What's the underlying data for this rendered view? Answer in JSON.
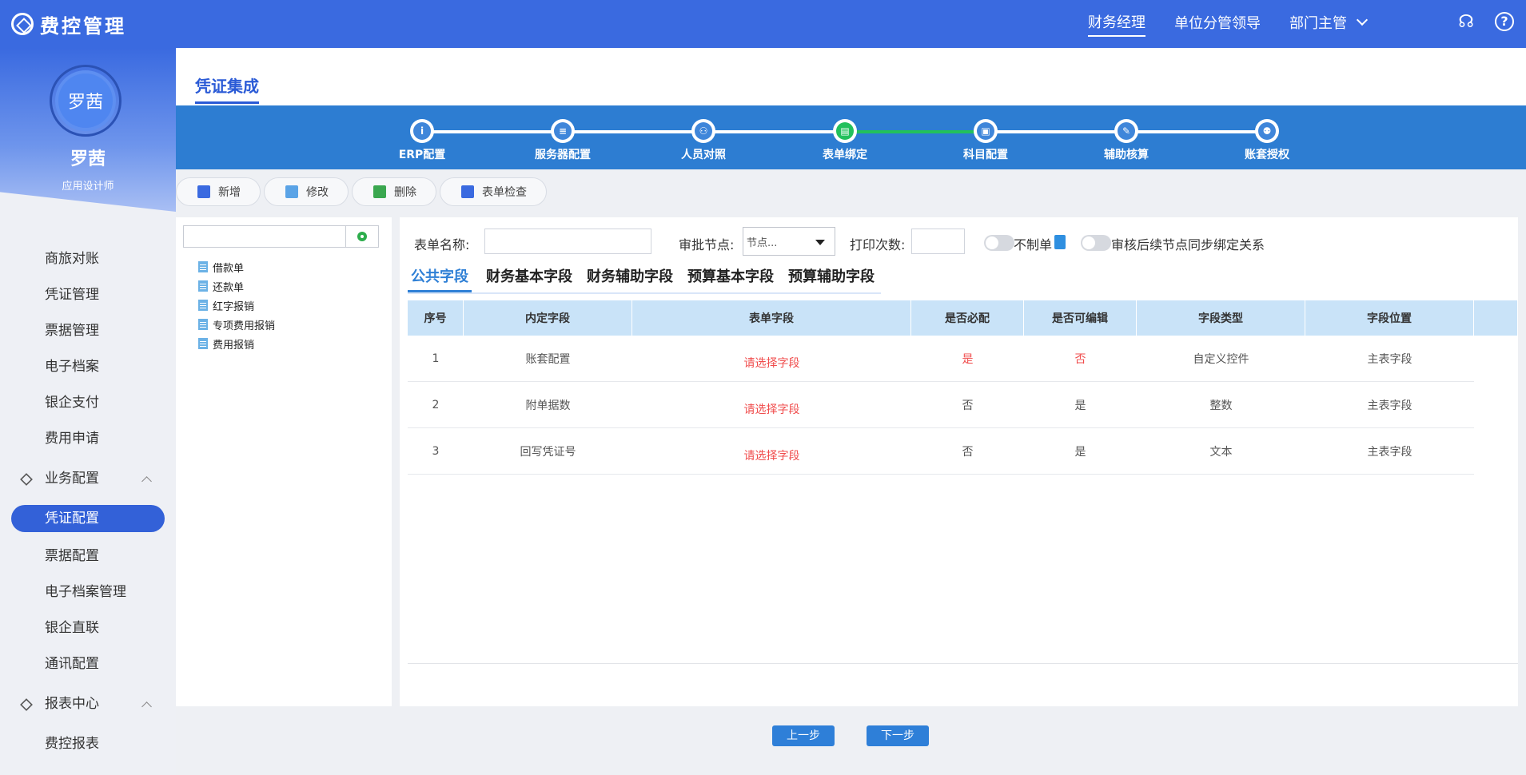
{
  "app": {
    "title": "费控管理"
  },
  "header": {
    "roles": [
      "财务经理",
      "单位分管领导",
      "部门主管"
    ],
    "active_role": "财务经理"
  },
  "profile": {
    "avatar_text": "罗茜",
    "name": "罗茜",
    "title": "应用设计师"
  },
  "sidebar": {
    "items_top": [
      "商旅对账",
      "凭证管理",
      "票据管理",
      "电子档案",
      "银企支付",
      "费用申请"
    ],
    "group1": "业务配置",
    "group1_items": [
      "凭证配置",
      "票据配置",
      "电子档案管理",
      "银企直联",
      "通讯配置"
    ],
    "active_item": "凭证配置",
    "group2": "报表中心",
    "group2_items": [
      "费控报表"
    ]
  },
  "page": {
    "title": "凭证集成"
  },
  "steps": [
    {
      "label": "ERP配置",
      "glyph": "i"
    },
    {
      "label": "服务器配置",
      "glyph": "≡"
    },
    {
      "label": "人员对照",
      "glyph": "⚇"
    },
    {
      "label": "表单绑定",
      "glyph": "▤"
    },
    {
      "label": "科目配置",
      "glyph": "▣"
    },
    {
      "label": "辅助核算",
      "glyph": "✎"
    },
    {
      "label": "账套授权",
      "glyph": "⚉"
    }
  ],
  "active_step": 3,
  "toolbar": {
    "add": "新增",
    "edit": "修改",
    "delete": "删除",
    "check": "表单检查"
  },
  "tree": {
    "search_value": "",
    "items": [
      "借款单",
      "还款单",
      "红字报销",
      "专项费用报销",
      "费用报销"
    ]
  },
  "form": {
    "name_label": "表单名称:",
    "name_value": "",
    "node_label": "审批节点:",
    "node_placeholder": "节点...",
    "print_label": "打印次数:",
    "print_value": "",
    "no_voucher_label": "不制单",
    "sync_label": "审核后续节点同步绑定关系"
  },
  "tabs": [
    "公共字段",
    "财务基本字段",
    "财务辅助字段",
    "预算基本字段",
    "预算辅助字段"
  ],
  "active_tab": "公共字段",
  "table": {
    "headers": [
      "序号",
      "内定字段",
      "表单字段",
      "是否必配",
      "是否可编辑",
      "字段类型",
      "字段位置"
    ],
    "rows": [
      {
        "no": "1",
        "builtin": "账套配置",
        "form_field": "请选择字段",
        "required": "是",
        "editable": "否",
        "type": "自定义控件",
        "position": "主表字段"
      },
      {
        "no": "2",
        "builtin": "附单据数",
        "form_field": "请选择字段",
        "required": "否",
        "editable": "是",
        "type": "整数",
        "position": "主表字段"
      },
      {
        "no": "3",
        "builtin": "回写凭证号",
        "form_field": "请选择字段",
        "required": "否",
        "editable": "是",
        "type": "文本",
        "position": "主表字段"
      }
    ]
  },
  "nav": {
    "prev": "上一步",
    "next": "下一步"
  },
  "colors": {
    "primary": "#3a6ae0",
    "stepper": "#2d7dd2",
    "done": "#22c05c",
    "alert": "#f04c4c"
  }
}
